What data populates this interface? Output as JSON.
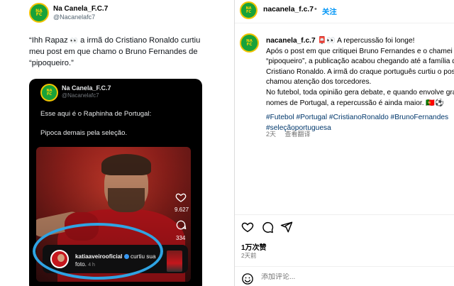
{
  "tweet": {
    "logo_text": "Na\nC",
    "author_name": "Na Canela_F.C.7",
    "author_handle": "@Nacanelafc7",
    "text_part1": "“Ihh Rapaz ",
    "eyes": "👀",
    "text_part2": " a irmã do Cristiano Ronaldo curtiu meu post em que chamo o Bruno Fernandes de “pipoqueiro.”"
  },
  "embedded_card": {
    "author_name": "Na Canela_F.C.7",
    "author_handle": "@Nacanelafc7",
    "line1": "Esse aqui é o Raphinha de Portugal:",
    "line2": "Pipoca demais pela seleção.",
    "like_count": "9.627",
    "comment_count": "334",
    "notification": {
      "user": "katiaaveirooficial",
      "action": " curtiu sua foto.",
      "time": "4 h"
    }
  },
  "instagram": {
    "username": "nacanela_f.c.7",
    "separator": "•",
    "follow_label": "关注",
    "caption_lines": [
      "📮👀 A repercussão foi longe!",
      "Após o post em que critiquei Bruno Fernandes e o chamei de",
      "“pipoqueiro”, a publicação acabou chegando até a família de",
      "Cristiano Ronaldo. A irmã do craque português curtiu o post e",
      "chamou atenção dos torcedores.",
      "No futebol, toda opinião gera debate, e quando envolve grandes",
      "nomes de Portugal, a repercussão é ainda maior. 🇵🇹⚽"
    ],
    "hashtags_line1": "#Futebol #Portugal #CristianoRonaldo #BrunoFernandes",
    "hashtags_line2": "#seleçãoportuguesa",
    "caption_age": "2天",
    "translate_label": "查看翻译",
    "likes": "1万次赞",
    "date": "2天前",
    "comment_placeholder": "添加评论..."
  },
  "colors": {
    "link_blue": "#0095f6",
    "hashtag_blue": "#00376b",
    "highlight_circle": "#2fa4e3",
    "logo_green": "#18a23a",
    "logo_yellow": "#f2c400"
  }
}
